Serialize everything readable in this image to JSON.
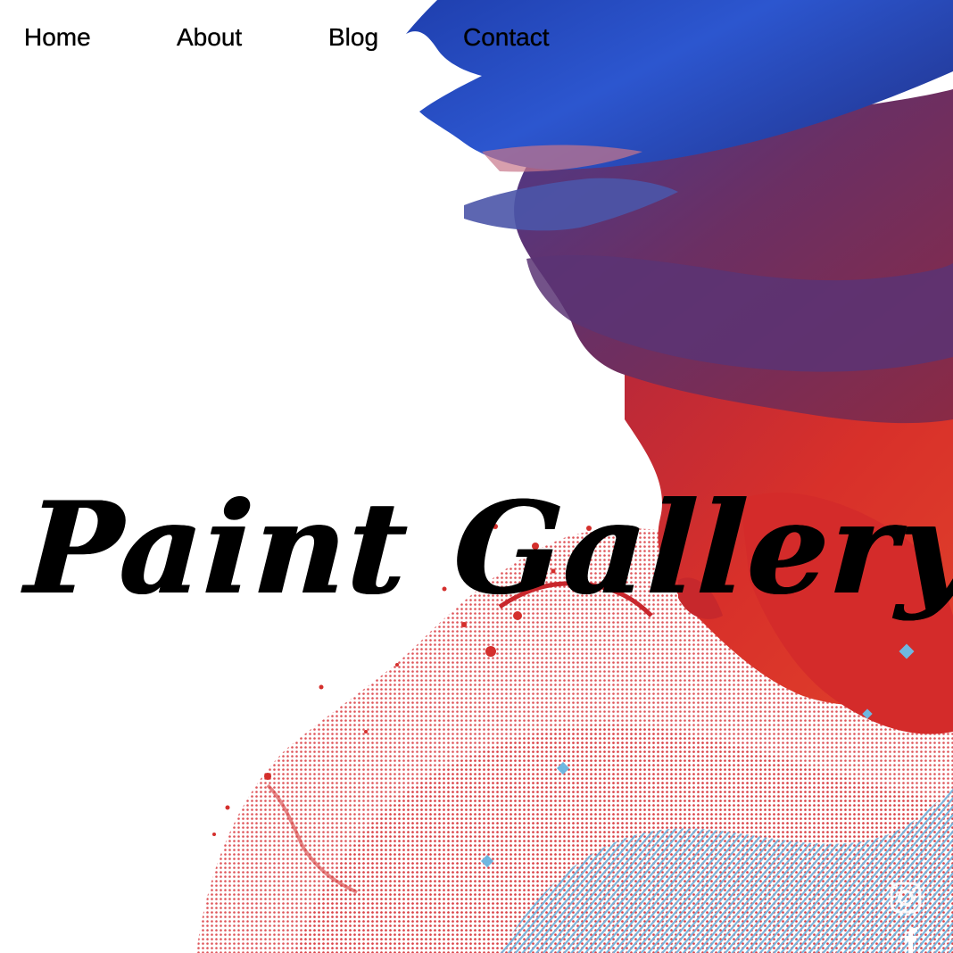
{
  "nav": {
    "items": [
      {
        "label": "Home"
      },
      {
        "label": "About"
      },
      {
        "label": "Blog"
      },
      {
        "label": "Contact"
      }
    ]
  },
  "hero": {
    "title": "Paint Gallery"
  },
  "social": {
    "instagram_icon": "instagram-icon",
    "facebook_icon": "facebook-icon"
  },
  "colors": {
    "blue": "#2d4fc2",
    "purple": "#6a2e5e",
    "red": "#d42f2c",
    "light_blue": "#7bb7dd",
    "text": "#000000"
  }
}
